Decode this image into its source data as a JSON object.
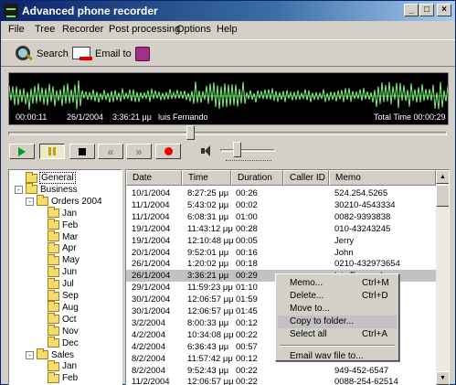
{
  "window": {
    "title": "Advanced phone recorder"
  },
  "menubar": [
    "File",
    "Tree",
    "Recorder",
    "Post processing",
    "Options",
    "Help"
  ],
  "toolbar": {
    "search_label": "Search",
    "email_label": "Email to"
  },
  "waveform": {
    "position": "00:00:11",
    "date": "26/1/2004",
    "time": "3:36:21 μμ",
    "caller": "luis Fernando",
    "total": "Total Time 00:00:29"
  },
  "tree": [
    {
      "label": "General",
      "level": 0,
      "selected": true
    },
    {
      "label": "Business",
      "level": 0,
      "expander": "-"
    },
    {
      "label": "Orders 2004",
      "level": 1,
      "expander": "-"
    },
    {
      "label": "Jan",
      "level": 2
    },
    {
      "label": "Feb",
      "level": 2
    },
    {
      "label": "Mar",
      "level": 2
    },
    {
      "label": "Apr",
      "level": 2
    },
    {
      "label": "May",
      "level": 2
    },
    {
      "label": "Jun",
      "level": 2
    },
    {
      "label": "Jul",
      "level": 2
    },
    {
      "label": "Sep",
      "level": 2
    },
    {
      "label": "Aug",
      "level": 2
    },
    {
      "label": "Oct",
      "level": 2
    },
    {
      "label": "Nov",
      "level": 2
    },
    {
      "label": "Dec",
      "level": 2
    },
    {
      "label": "Sales",
      "level": 1,
      "expander": "-"
    },
    {
      "label": "Jan",
      "level": 2
    },
    {
      "label": "Feb",
      "level": 2
    }
  ],
  "list": {
    "columns": [
      "Date",
      "Time",
      "Duration",
      "Caller ID",
      "Memo"
    ],
    "rows": [
      [
        "10/1/2004",
        "8:27:25 μμ",
        "00:26",
        "",
        "524.254.5265"
      ],
      [
        "11/1/2004",
        "5:43:02 μμ",
        "00:02",
        "",
        "30210-4543334"
      ],
      [
        "11/1/2004",
        "6:08:31 μμ",
        "01:00",
        "",
        "0082-9393838"
      ],
      [
        "19/1/2004",
        "11:43:12 μμ",
        "00:28",
        "",
        "010-43243245"
      ],
      [
        "19/1/2004",
        "12:10:48 μμ",
        "00:05",
        "",
        "Jerry"
      ],
      [
        "20/1/2004",
        "9:52:01 μμ",
        "00:16",
        "",
        "John"
      ],
      [
        "26/1/2004",
        "1:20:02 μμ",
        "00:18",
        "",
        "0210-432973654"
      ],
      [
        "26/1/2004",
        "3:36:21 μμ",
        "00:29",
        "",
        "luis Fernando"
      ],
      [
        "29/1/2004",
        "11:59:23 μμ",
        "01:10",
        "",
        ""
      ],
      [
        "30/1/2004",
        "12:06:57 μμ",
        "01:59",
        "",
        ""
      ],
      [
        "30/1/2004",
        "12:06:57 μμ",
        "01:45",
        "",
        ""
      ],
      [
        "3/2/2004",
        "8:00:33 μμ",
        "00:12",
        "",
        ""
      ],
      [
        "4/2/2004",
        "10:34:08 μμ",
        "00:22",
        "",
        ""
      ],
      [
        "4/2/2004",
        "6:36:43 μμ",
        "00:57",
        "",
        ""
      ],
      [
        "8/2/2004",
        "11:57:42 μμ",
        "00:12",
        "",
        ""
      ],
      [
        "8/2/2004",
        "9:52:43 μμ",
        "00:22",
        "",
        "949-452-6547"
      ],
      [
        "11/2/2004",
        "12:06:57 μμ",
        "00:22",
        "",
        "0088-254-62514"
      ]
    ],
    "selected_index": 7
  },
  "context_menu": [
    {
      "label": "Memo...",
      "accel": "Ctrl+M"
    },
    {
      "label": "Delete...",
      "accel": "Ctrl+D"
    },
    {
      "label": "Move to...",
      "accel": ""
    },
    {
      "label": "Copy to folder...",
      "accel": "",
      "highlighted": true
    },
    {
      "label": "Select all",
      "accel": "Ctrl+A"
    },
    {
      "separator": true
    },
    {
      "label": "Email wav file to...",
      "accel": ""
    }
  ]
}
